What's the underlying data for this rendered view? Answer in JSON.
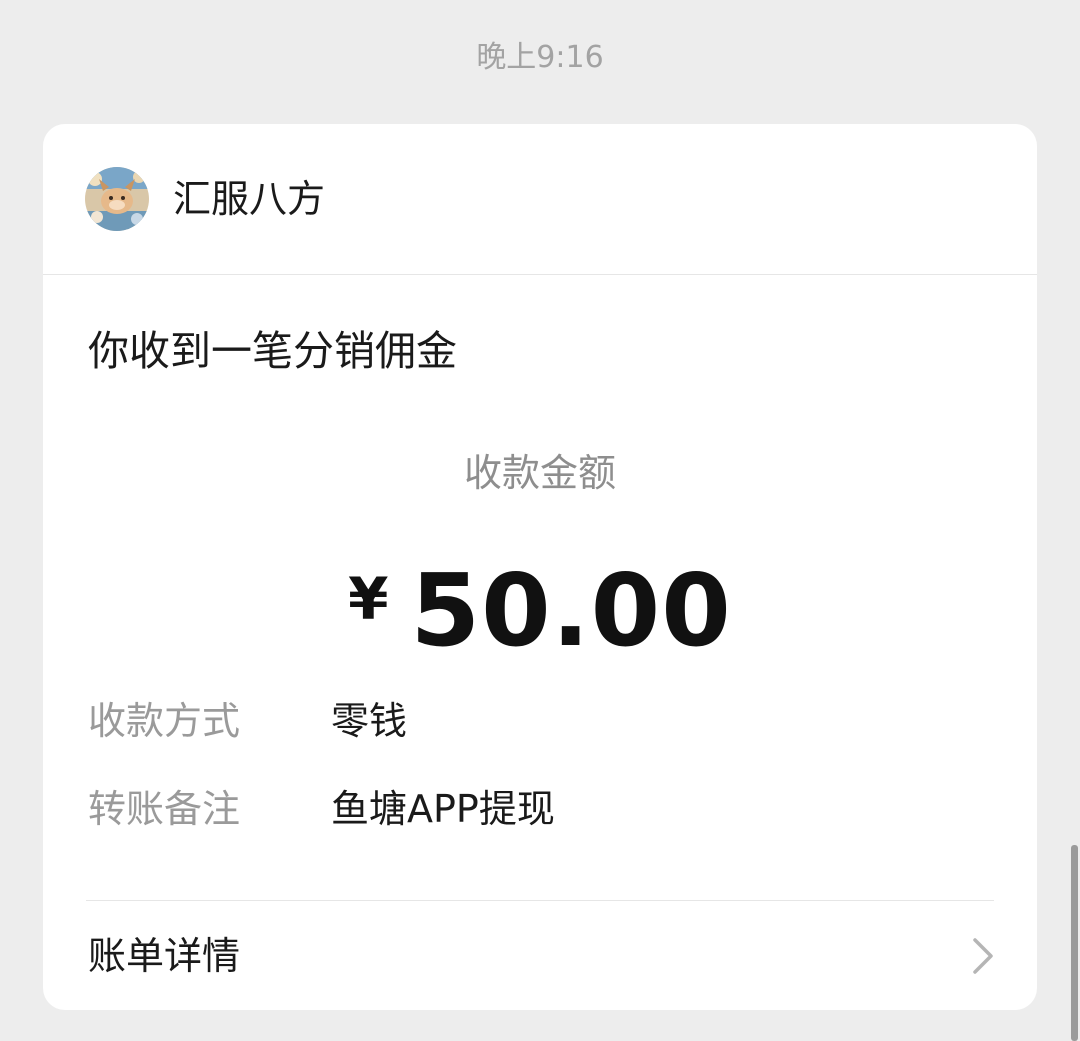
{
  "timestamp": "晚上9:16",
  "sender": {
    "name": "汇服八方",
    "avatar_icon": "cartoon-avatar-icon"
  },
  "message": {
    "title": "你收到一笔分销佣金",
    "amount_label": "收款金额",
    "currency_symbol": "¥",
    "amount": "50.00",
    "rows": [
      {
        "label": "收款方式",
        "value": "零钱"
      },
      {
        "label": "转账备注",
        "value": "鱼塘APP提现"
      }
    ],
    "details_label": "账单详情",
    "details_icon": "chevron-right-icon"
  },
  "colors": {
    "background": "#ededed",
    "card": "#ffffff",
    "secondary_text": "#9a9a9a",
    "primary_text": "#1a1a1a"
  }
}
